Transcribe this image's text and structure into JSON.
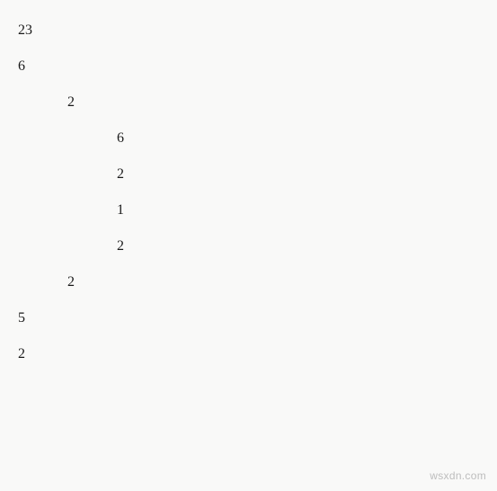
{
  "lines": [
    {
      "indent": 0,
      "value": "23"
    },
    {
      "indent": 0,
      "value": "6"
    },
    {
      "indent": 1,
      "value": "2"
    },
    {
      "indent": 2,
      "value": "6"
    },
    {
      "indent": 2,
      "value": "2"
    },
    {
      "indent": 2,
      "value": "1"
    },
    {
      "indent": 2,
      "value": "2"
    },
    {
      "indent": 1,
      "value": "2"
    },
    {
      "indent": 0,
      "value": "5"
    },
    {
      "indent": 0,
      "value": "2"
    }
  ],
  "watermark": "wsxdn.com"
}
